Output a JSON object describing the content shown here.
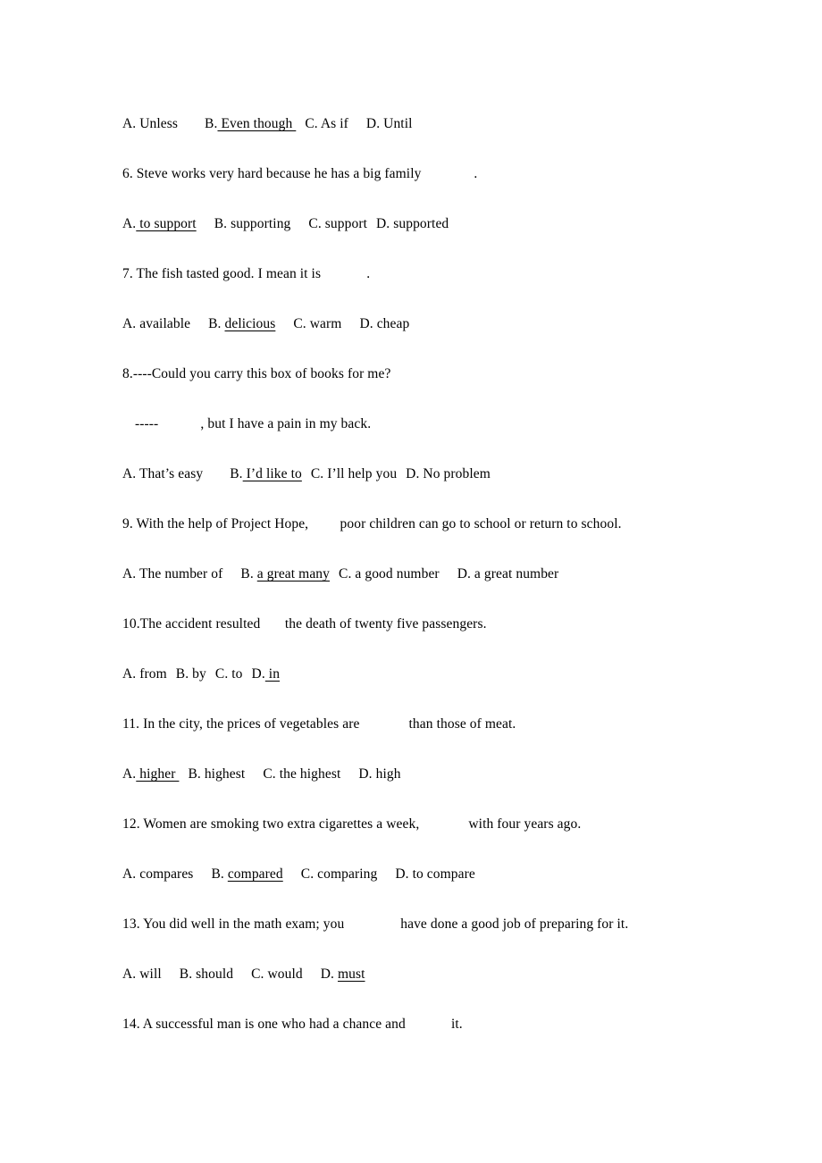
{
  "document": {
    "type": "english-grammar-multiple-choice-worksheet",
    "page_background": "#ffffff",
    "text_color": "#000000"
  },
  "lines": [
    {
      "id": "q5-options",
      "kind": "options",
      "segments": [
        {
          "text": "A. Unless",
          "underline": false
        },
        {
          "gap": "lg"
        },
        {
          "text": "B.",
          "underline": false
        },
        {
          "text": " Even though ",
          "underline": true
        },
        {
          "gap": "sm"
        },
        {
          "text": "C. As if",
          "underline": false
        },
        {
          "gap": "md"
        },
        {
          "text": "D. Until",
          "underline": false
        }
      ]
    },
    {
      "id": "q6-stem",
      "kind": "stem",
      "segments": [
        {
          "text": "6. Steve works very hard because he has a big family ",
          "underline": false
        },
        {
          "blank": "_______"
        },
        {
          "text": ".",
          "underline": false
        }
      ]
    },
    {
      "id": "q6-options",
      "kind": "options",
      "segments": [
        {
          "text": "A.",
          "underline": false
        },
        {
          "text": " to support",
          "underline": true
        },
        {
          "gap": "md"
        },
        {
          "text": "B. supporting",
          "underline": false
        },
        {
          "gap": "md"
        },
        {
          "text": "C. support",
          "underline": false
        },
        {
          "gap": "sm"
        },
        {
          "text": "D. supported",
          "underline": false
        }
      ]
    },
    {
      "id": "q7-stem",
      "kind": "stem",
      "segments": [
        {
          "text": "7. The fish tasted good. I mean it is ",
          "underline": false
        },
        {
          "blank": "______"
        },
        {
          "text": ".",
          "underline": false
        }
      ]
    },
    {
      "id": "q7-options",
      "kind": "options",
      "segments": [
        {
          "text": "A. available",
          "underline": false
        },
        {
          "gap": "md"
        },
        {
          "text": "B. ",
          "underline": false
        },
        {
          "text": "delicious",
          "underline": true
        },
        {
          "gap": "md"
        },
        {
          "text": "C. warm",
          "underline": false
        },
        {
          "gap": "md"
        },
        {
          "text": "D. cheap",
          "underline": false
        }
      ]
    },
    {
      "id": "q8-stem",
      "kind": "stem",
      "segments": [
        {
          "text": "8.----Could you carry this box of books for me?",
          "underline": false
        }
      ]
    },
    {
      "id": "q8-reply",
      "kind": "stem-indent",
      "segments": [
        {
          "text": " -----",
          "underline": false
        },
        {
          "blank": "______"
        },
        {
          "text": ", but I have a pain in my back.",
          "underline": false
        }
      ]
    },
    {
      "id": "q8-options",
      "kind": "options",
      "segments": [
        {
          "text": "A. That’s easy",
          "underline": false
        },
        {
          "gap": "lg"
        },
        {
          "text": "B.",
          "underline": false
        },
        {
          "text": " I’d like to",
          "underline": true
        },
        {
          "gap": "sm"
        },
        {
          "text": "C. I’ll help you",
          "underline": false
        },
        {
          "gap": "sm"
        },
        {
          "text": "D. No problem",
          "underline": false
        }
      ]
    },
    {
      "id": "q9-stem",
      "kind": "stem",
      "segments": [
        {
          "text": "9. With the help of Project Hope, ",
          "underline": false
        },
        {
          "blank": "____"
        },
        {
          "text": "poor children can go to school or return to school.",
          "underline": false
        }
      ]
    },
    {
      "id": "q9-options",
      "kind": "options",
      "segments": [
        {
          "text": "A. The number of",
          "underline": false
        },
        {
          "gap": "md"
        },
        {
          "text": "B. ",
          "underline": false
        },
        {
          "text": "a great many",
          "underline": true
        },
        {
          "gap": "sm"
        },
        {
          "text": "C. a good number",
          "underline": false
        },
        {
          "gap": "md"
        },
        {
          "text": "D. a great number",
          "underline": false
        }
      ]
    },
    {
      "id": "q10-stem",
      "kind": "stem",
      "segments": [
        {
          "text": "10.The accident resulted ",
          "underline": false
        },
        {
          "blank": "___"
        },
        {
          "text": "the death of twenty five passengers.",
          "underline": false
        }
      ]
    },
    {
      "id": "q10-options",
      "kind": "options",
      "segments": [
        {
          "text": "A. from",
          "underline": false
        },
        {
          "gap": "sm"
        },
        {
          "text": "B. by",
          "underline": false
        },
        {
          "gap": "sm"
        },
        {
          "text": "C. to",
          "underline": false
        },
        {
          "gap": "sm"
        },
        {
          "text": "D.",
          "underline": false
        },
        {
          "text": " in",
          "underline": true
        }
      ]
    },
    {
      "id": "q11-stem",
      "kind": "stem",
      "segments": [
        {
          "text": "11. In the city, the prices of vegetables are ",
          "underline": false
        },
        {
          "blank": "______"
        },
        {
          "text": " than those of meat.",
          "underline": false
        }
      ]
    },
    {
      "id": "q11-options",
      "kind": "options",
      "segments": [
        {
          "text": "A.",
          "underline": false
        },
        {
          "text": " higher ",
          "underline": true
        },
        {
          "gap": "sm"
        },
        {
          "text": "B. highest",
          "underline": false
        },
        {
          "gap": "md"
        },
        {
          "text": "C. the highest",
          "underline": false
        },
        {
          "gap": "md"
        },
        {
          "text": "D. high",
          "underline": false
        }
      ]
    },
    {
      "id": "q12-stem",
      "kind": "stem",
      "segments": [
        {
          "text": "12. Women are smoking two extra cigarettes a week, ",
          "underline": false
        },
        {
          "blank": "______"
        },
        {
          "text": " with four years ago.",
          "underline": false
        }
      ]
    },
    {
      "id": "q12-options",
      "kind": "options",
      "segments": [
        {
          "text": "A. compares",
          "underline": false
        },
        {
          "gap": "md"
        },
        {
          "text": "B. ",
          "underline": false
        },
        {
          "text": "compared",
          "underline": true
        },
        {
          "gap": "md"
        },
        {
          "text": "C. comparing",
          "underline": false
        },
        {
          "gap": "md"
        },
        {
          "text": "D. to compare",
          "underline": false
        }
      ]
    },
    {
      "id": "q13-stem",
      "kind": "stem",
      "segments": [
        {
          "text": "13. You did well in the math exam; you ",
          "underline": false
        },
        {
          "blank": "_______"
        },
        {
          "text": " have done a good job of preparing for it.",
          "underline": false
        }
      ]
    },
    {
      "id": "q13-options",
      "kind": "options",
      "segments": [
        {
          "text": "A. will",
          "underline": false
        },
        {
          "gap": "md"
        },
        {
          "text": "B. should",
          "underline": false
        },
        {
          "gap": "md"
        },
        {
          "text": "C. would",
          "underline": false
        },
        {
          "gap": "md"
        },
        {
          "text": "D. ",
          "underline": false
        },
        {
          "text": "must",
          "underline": true
        }
      ]
    },
    {
      "id": "q14-stem",
      "kind": "stem",
      "segments": [
        {
          "text": "14. A successful man is one who had a chance and ",
          "underline": false
        },
        {
          "blank": "______"
        },
        {
          "text": "it.",
          "underline": false
        }
      ]
    }
  ]
}
